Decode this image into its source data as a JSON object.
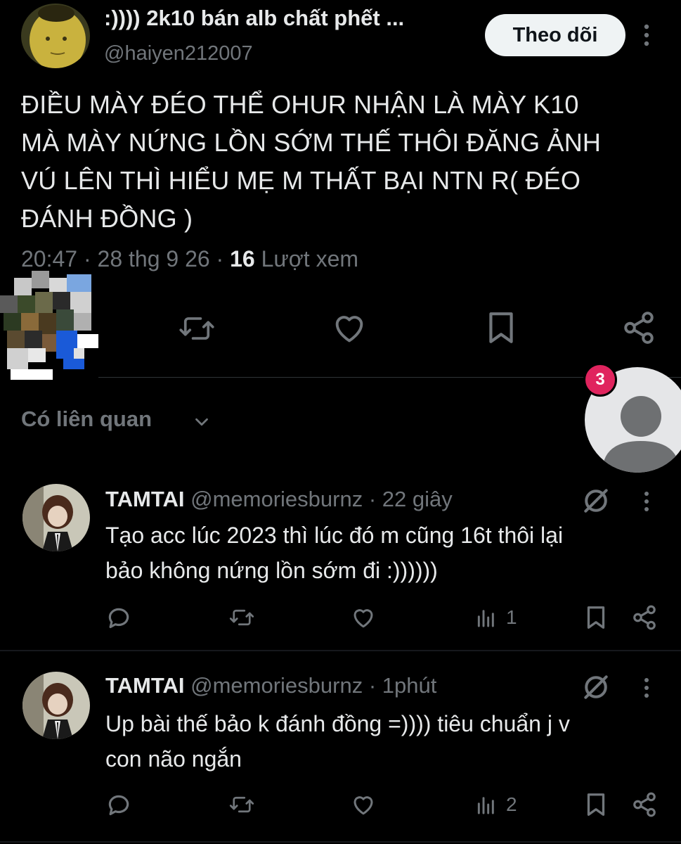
{
  "main_tweet": {
    "author_name": ":)))) 2k10 bán alb chất phết ...",
    "author_handle": "@haiyen212007",
    "follow_label": "Theo dõi",
    "body_lines": [
      "ĐIỀU MÀY ĐÉO THỂ OHUR NHẬN LÀ MÀY K10",
      "MÀ MÀY NỨNG LỒN SỚM THẾ THÔI ĐĂNG ẢNH",
      "VÚ LÊN THÌ HIỂU MẸ M THẤT BẠI NTN R( ĐÉO",
      "ĐÁNH ĐỒNG )"
    ],
    "time": "20:47",
    "date": "28 thg 9 26",
    "views_count": "16",
    "views_label": "Lượt xem"
  },
  "related": {
    "label": "Có liên quan"
  },
  "floating_bubble": {
    "badge_count": "3"
  },
  "replies": [
    {
      "name": "TAMTAI",
      "handle": "@memoriesburnz",
      "time": "22 giây",
      "lines": [
        "Tạo acc lúc 2023 thì lúc đó m cũng 16t thôi lại",
        "bảo không nứng lồn sớm đi :))))))"
      ],
      "views": "1"
    },
    {
      "name": "TAMTAI",
      "handle": "@memoriesburnz",
      "time": "1phút",
      "lines": [
        "Up bài thế bảo k đánh đồng =)))) tiêu chuẩn j v",
        "con não ngắn"
      ],
      "views": "2"
    }
  ],
  "colors": {
    "background": "#000000",
    "text": "#e7e9ea",
    "muted": "#71767b",
    "badge": "#e0245e",
    "follow_bg": "#eff3f4"
  },
  "icons": [
    "more-icon",
    "retweet-icon",
    "like-icon",
    "bookmark-icon",
    "share-icon",
    "reply-icon",
    "views-icon",
    "grok-icon",
    "chevron-down-icon",
    "default-avatar-icon"
  ]
}
